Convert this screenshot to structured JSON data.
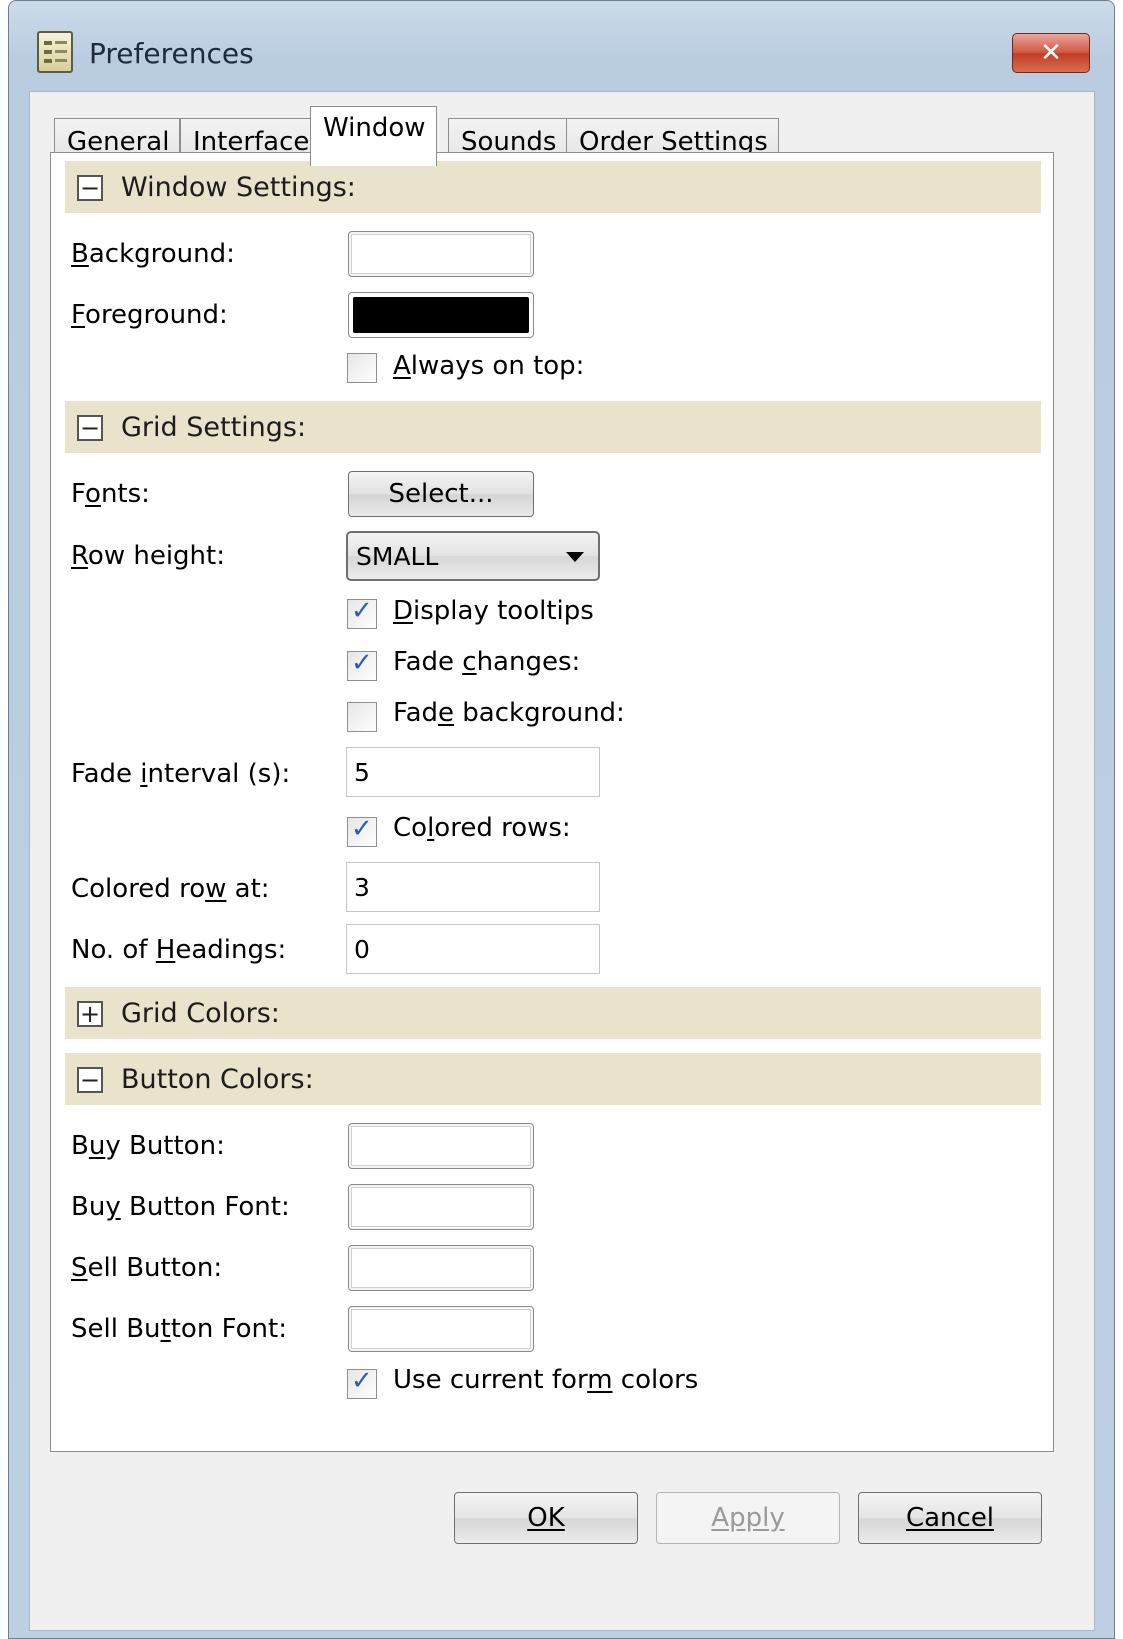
{
  "window": {
    "title": "Preferences",
    "close_glyph": "✕"
  },
  "tabs": [
    {
      "label": "General"
    },
    {
      "label": "Interface"
    },
    {
      "label": "Window"
    },
    {
      "label": "Sounds"
    },
    {
      "label": "Order Settings"
    }
  ],
  "active_tab": "Window",
  "window_settings": {
    "header": "Window Settings:",
    "toggle": "−",
    "background_label": "Background:",
    "foreground_label": "Foreground:",
    "foreground_color": "#000000",
    "always_on_top_label": "Always on top:",
    "always_on_top": false
  },
  "grid_settings": {
    "header": "Grid Settings:",
    "toggle": "−",
    "fonts_label": "Fonts:",
    "select_button": "Select...",
    "row_height_label": "Row height:",
    "row_height_value": "SMALL",
    "display_tooltips_label": "Display tooltips",
    "display_tooltips": true,
    "fade_changes_label": "Fade changes:",
    "fade_changes": true,
    "fade_background_label": "Fade background:",
    "fade_background": false,
    "fade_interval_label": "Fade interval (s):",
    "fade_interval_value": "5",
    "colored_rows_label": "Colored rows:",
    "colored_rows": true,
    "colored_row_at_label": "Colored row at:",
    "colored_row_at_value": "3",
    "headings_label": "No. of Headings:",
    "headings_value": "0"
  },
  "grid_colors": {
    "header": "Grid Colors:",
    "toggle": "+"
  },
  "button_colors": {
    "header": "Button Colors:",
    "toggle": "−",
    "buy_button_label": "Buy Button:",
    "buy_button_font_label": "Buy Button Font:",
    "sell_button_label": "Sell Button:",
    "sell_button_font_label": "Sell Button Font:",
    "use_current_label": "Use current form colors",
    "use_current": true
  },
  "footer": {
    "ok": "OK",
    "apply": "Apply",
    "cancel": "Cancel"
  },
  "check_glyph": "✓",
  "colors": {
    "section_bg": "#e8e3ca",
    "check_color": "#2a5fb0"
  }
}
